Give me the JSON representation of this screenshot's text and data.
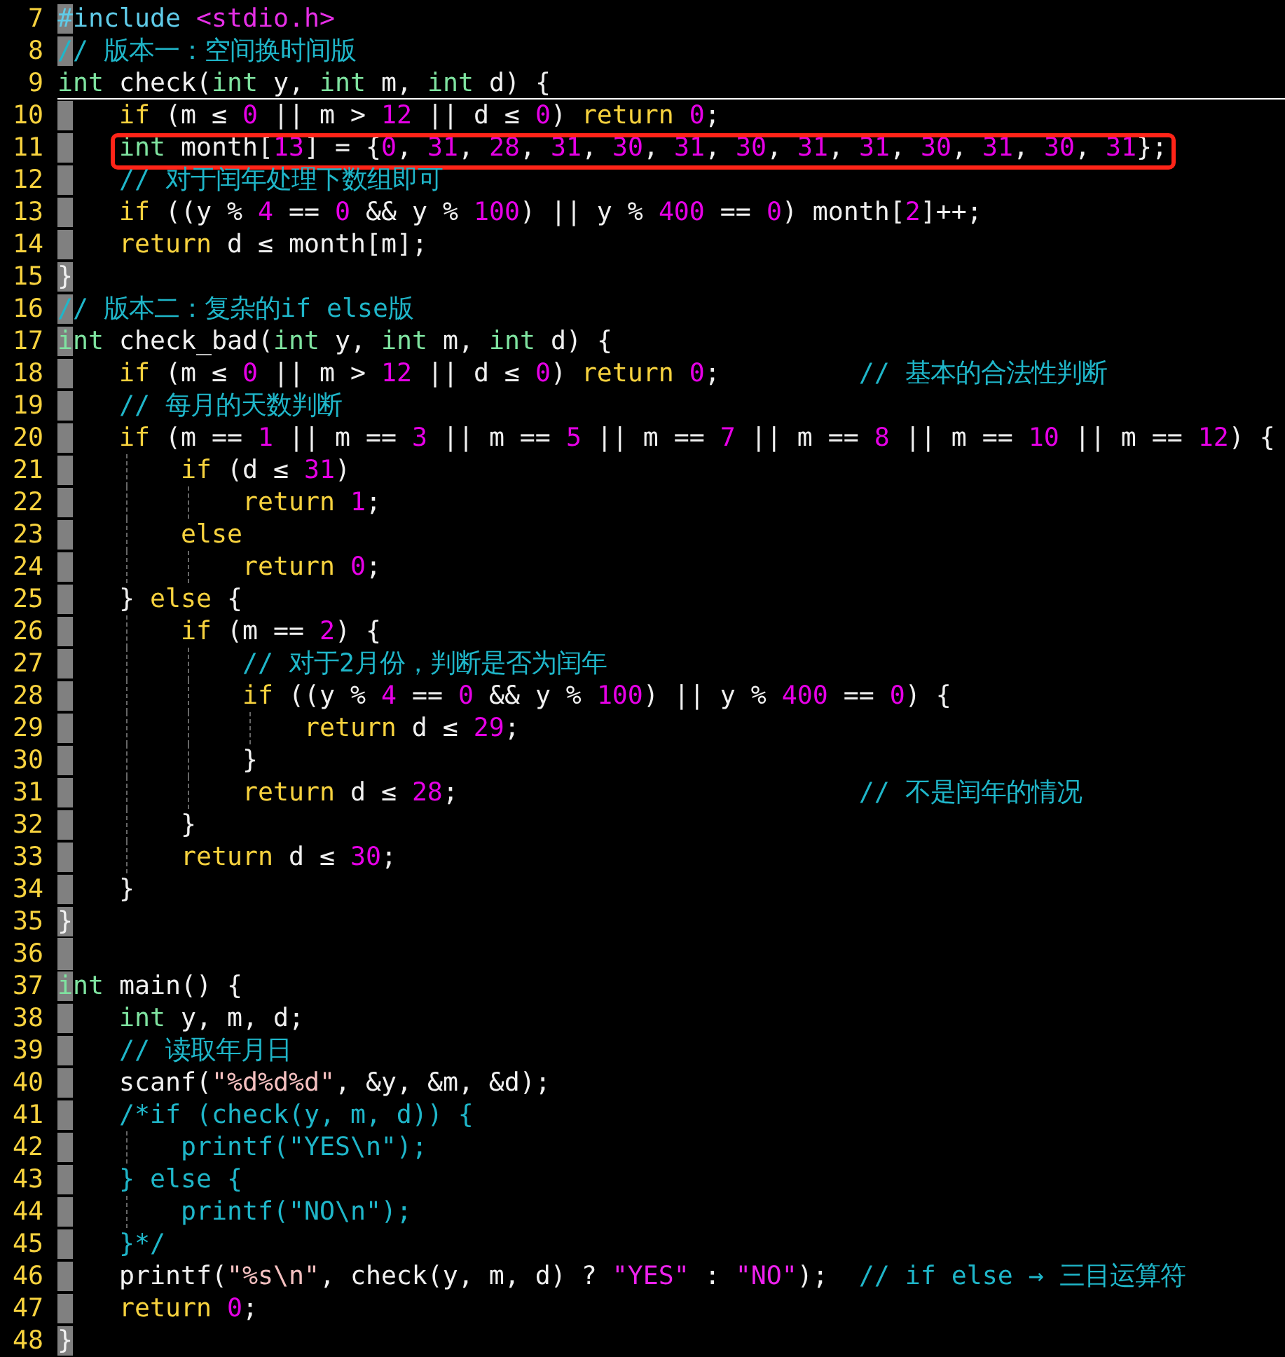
{
  "editor": {
    "lines": [
      {
        "number": "7",
        "current": false,
        "boxed": false,
        "tokens": [
          {
            "text": "#include",
            "kind": "preproc"
          },
          {
            "text": " <stdio.h>",
            "kind": "include"
          }
        ]
      },
      {
        "number": "8",
        "current": false,
        "boxed": false,
        "tokens": [
          {
            "text": "// 版本一：空间换时间版",
            "kind": "comment"
          }
        ]
      },
      {
        "number": "9",
        "current": true,
        "boxed": false,
        "tokens": [
          {
            "text": "int",
            "kind": "type"
          },
          {
            "text": " check(",
            "kind": "plain"
          },
          {
            "text": "int",
            "kind": "type"
          },
          {
            "text": " y, ",
            "kind": "plain"
          },
          {
            "text": "int",
            "kind": "type"
          },
          {
            "text": " m, ",
            "kind": "plain"
          },
          {
            "text": "int",
            "kind": "type"
          },
          {
            "text": " d) {",
            "kind": "plain"
          }
        ]
      },
      {
        "number": "10",
        "current": false,
        "boxed": false,
        "tokens": [
          {
            "text": "    if",
            "kind": "keyword"
          },
          {
            "text": " (m ≤ ",
            "kind": "plain"
          },
          {
            "text": "0",
            "kind": "number"
          },
          {
            "text": " || m > ",
            "kind": "plain"
          },
          {
            "text": "12",
            "kind": "number"
          },
          {
            "text": " || d ≤ ",
            "kind": "plain"
          },
          {
            "text": "0",
            "kind": "number"
          },
          {
            "text": ") ",
            "kind": "plain"
          },
          {
            "text": "return",
            "kind": "keyword"
          },
          {
            "text": " 0",
            "kind": "number"
          },
          {
            "text": ";",
            "kind": "plain"
          }
        ]
      },
      {
        "number": "11",
        "current": false,
        "boxed": true,
        "tokens": [
          {
            "text": "    int",
            "kind": "type"
          },
          {
            "text": " month[",
            "kind": "plain"
          },
          {
            "text": "13",
            "kind": "number"
          },
          {
            "text": "] = {",
            "kind": "plain"
          },
          {
            "text": "0",
            "kind": "number"
          },
          {
            "text": ", ",
            "kind": "plain"
          },
          {
            "text": "31",
            "kind": "number"
          },
          {
            "text": ", ",
            "kind": "plain"
          },
          {
            "text": "28",
            "kind": "number"
          },
          {
            "text": ", ",
            "kind": "plain"
          },
          {
            "text": "31",
            "kind": "number"
          },
          {
            "text": ", ",
            "kind": "plain"
          },
          {
            "text": "30",
            "kind": "number"
          },
          {
            "text": ", ",
            "kind": "plain"
          },
          {
            "text": "31",
            "kind": "number"
          },
          {
            "text": ", ",
            "kind": "plain"
          },
          {
            "text": "30",
            "kind": "number"
          },
          {
            "text": ", ",
            "kind": "plain"
          },
          {
            "text": "31",
            "kind": "number"
          },
          {
            "text": ", ",
            "kind": "plain"
          },
          {
            "text": "31",
            "kind": "number"
          },
          {
            "text": ", ",
            "kind": "plain"
          },
          {
            "text": "30",
            "kind": "number"
          },
          {
            "text": ", ",
            "kind": "plain"
          },
          {
            "text": "31",
            "kind": "number"
          },
          {
            "text": ", ",
            "kind": "plain"
          },
          {
            "text": "30",
            "kind": "number"
          },
          {
            "text": ", ",
            "kind": "plain"
          },
          {
            "text": "31",
            "kind": "number"
          },
          {
            "text": "};",
            "kind": "plain"
          }
        ]
      },
      {
        "number": "12",
        "current": false,
        "boxed": false,
        "tokens": [
          {
            "text": "    // 对于闰年处理下数组即可",
            "kind": "comment"
          }
        ]
      },
      {
        "number": "13",
        "current": false,
        "boxed": false,
        "tokens": [
          {
            "text": "    if",
            "kind": "keyword"
          },
          {
            "text": " ((y % ",
            "kind": "plain"
          },
          {
            "text": "4",
            "kind": "number"
          },
          {
            "text": " == ",
            "kind": "plain"
          },
          {
            "text": "0",
            "kind": "number"
          },
          {
            "text": " && y % ",
            "kind": "plain"
          },
          {
            "text": "100",
            "kind": "number"
          },
          {
            "text": ") || y % ",
            "kind": "plain"
          },
          {
            "text": "400",
            "kind": "number"
          },
          {
            "text": " == ",
            "kind": "plain"
          },
          {
            "text": "0",
            "kind": "number"
          },
          {
            "text": ") month[",
            "kind": "plain"
          },
          {
            "text": "2",
            "kind": "number"
          },
          {
            "text": "]++;",
            "kind": "plain"
          }
        ]
      },
      {
        "number": "14",
        "current": false,
        "boxed": false,
        "tokens": [
          {
            "text": "    return",
            "kind": "keyword"
          },
          {
            "text": " d ≤ month[m];",
            "kind": "plain"
          }
        ]
      },
      {
        "number": "15",
        "current": false,
        "boxed": false,
        "tokens": [
          {
            "text": "}",
            "kind": "plain"
          }
        ]
      },
      {
        "number": "16",
        "current": false,
        "boxed": false,
        "tokens": [
          {
            "text": "// 版本二：复杂的if else版",
            "kind": "comment"
          }
        ]
      },
      {
        "number": "17",
        "current": false,
        "boxed": false,
        "tokens": [
          {
            "text": "int",
            "kind": "type"
          },
          {
            "text": " check_bad(",
            "kind": "plain"
          },
          {
            "text": "int",
            "kind": "type"
          },
          {
            "text": " y, ",
            "kind": "plain"
          },
          {
            "text": "int",
            "kind": "type"
          },
          {
            "text": " m, ",
            "kind": "plain"
          },
          {
            "text": "int",
            "kind": "type"
          },
          {
            "text": " d) {",
            "kind": "plain"
          }
        ]
      },
      {
        "number": "18",
        "current": false,
        "boxed": false,
        "tokens": [
          {
            "text": "    if",
            "kind": "keyword"
          },
          {
            "text": " (m ≤ ",
            "kind": "plain"
          },
          {
            "text": "0",
            "kind": "number"
          },
          {
            "text": " || m > ",
            "kind": "plain"
          },
          {
            "text": "12",
            "kind": "number"
          },
          {
            "text": " || d ≤ ",
            "kind": "plain"
          },
          {
            "text": "0",
            "kind": "number"
          },
          {
            "text": ") ",
            "kind": "plain"
          },
          {
            "text": "return",
            "kind": "keyword"
          },
          {
            "text": " 0",
            "kind": "number"
          },
          {
            "text": ";",
            "kind": "plain"
          },
          {
            "text": "         // 基本的合法性判断",
            "kind": "comment"
          }
        ]
      },
      {
        "number": "19",
        "current": false,
        "boxed": false,
        "tokens": [
          {
            "text": "    // 每月的天数判断",
            "kind": "comment"
          }
        ]
      },
      {
        "number": "20",
        "current": false,
        "boxed": false,
        "tokens": [
          {
            "text": "    if",
            "kind": "keyword"
          },
          {
            "text": " (m == ",
            "kind": "plain"
          },
          {
            "text": "1",
            "kind": "number"
          },
          {
            "text": " || m == ",
            "kind": "plain"
          },
          {
            "text": "3",
            "kind": "number"
          },
          {
            "text": " || m == ",
            "kind": "plain"
          },
          {
            "text": "5",
            "kind": "number"
          },
          {
            "text": " || m == ",
            "kind": "plain"
          },
          {
            "text": "7",
            "kind": "number"
          },
          {
            "text": " || m == ",
            "kind": "plain"
          },
          {
            "text": "8",
            "kind": "number"
          },
          {
            "text": " || m == ",
            "kind": "plain"
          },
          {
            "text": "10",
            "kind": "number"
          },
          {
            "text": " || m == ",
            "kind": "plain"
          },
          {
            "text": "12",
            "kind": "number"
          },
          {
            "text": ") {",
            "kind": "plain"
          }
        ]
      },
      {
        "number": "21",
        "current": false,
        "boxed": false,
        "tokens": [
          {
            "text": "        if",
            "kind": "keyword"
          },
          {
            "text": " (d ≤ ",
            "kind": "plain"
          },
          {
            "text": "31",
            "kind": "number"
          },
          {
            "text": ")",
            "kind": "plain"
          }
        ]
      },
      {
        "number": "22",
        "current": false,
        "boxed": false,
        "tokens": [
          {
            "text": "            return",
            "kind": "keyword"
          },
          {
            "text": " 1",
            "kind": "number"
          },
          {
            "text": ";",
            "kind": "plain"
          }
        ]
      },
      {
        "number": "23",
        "current": false,
        "boxed": false,
        "tokens": [
          {
            "text": "        else",
            "kind": "keyword"
          }
        ]
      },
      {
        "number": "24",
        "current": false,
        "boxed": false,
        "tokens": [
          {
            "text": "            return",
            "kind": "keyword"
          },
          {
            "text": " 0",
            "kind": "number"
          },
          {
            "text": ";",
            "kind": "plain"
          }
        ]
      },
      {
        "number": "25",
        "current": false,
        "boxed": false,
        "tokens": [
          {
            "text": "    }",
            "kind": "plain"
          },
          {
            "text": " else",
            "kind": "keyword"
          },
          {
            "text": " {",
            "kind": "plain"
          }
        ]
      },
      {
        "number": "26",
        "current": false,
        "boxed": false,
        "tokens": [
          {
            "text": "        if",
            "kind": "keyword"
          },
          {
            "text": " (m == ",
            "kind": "plain"
          },
          {
            "text": "2",
            "kind": "number"
          },
          {
            "text": ") {",
            "kind": "plain"
          }
        ]
      },
      {
        "number": "27",
        "current": false,
        "boxed": false,
        "tokens": [
          {
            "text": "            // 对于2月份，判断是否为闰年",
            "kind": "comment"
          }
        ]
      },
      {
        "number": "28",
        "current": false,
        "boxed": false,
        "tokens": [
          {
            "text": "            if",
            "kind": "keyword"
          },
          {
            "text": " ((y % ",
            "kind": "plain"
          },
          {
            "text": "4",
            "kind": "number"
          },
          {
            "text": " == ",
            "kind": "plain"
          },
          {
            "text": "0",
            "kind": "number"
          },
          {
            "text": " && y % ",
            "kind": "plain"
          },
          {
            "text": "100",
            "kind": "number"
          },
          {
            "text": ") || y % ",
            "kind": "plain"
          },
          {
            "text": "400",
            "kind": "number"
          },
          {
            "text": " == ",
            "kind": "plain"
          },
          {
            "text": "0",
            "kind": "number"
          },
          {
            "text": ") {",
            "kind": "plain"
          }
        ]
      },
      {
        "number": "29",
        "current": false,
        "boxed": false,
        "tokens": [
          {
            "text": "                return",
            "kind": "keyword"
          },
          {
            "text": " d ≤ ",
            "kind": "plain"
          },
          {
            "text": "29",
            "kind": "number"
          },
          {
            "text": ";",
            "kind": "plain"
          }
        ]
      },
      {
        "number": "30",
        "current": false,
        "boxed": false,
        "tokens": [
          {
            "text": "            }",
            "kind": "plain"
          }
        ]
      },
      {
        "number": "31",
        "current": false,
        "boxed": false,
        "tokens": [
          {
            "text": "            return",
            "kind": "keyword"
          },
          {
            "text": " d ≤ ",
            "kind": "plain"
          },
          {
            "text": "28",
            "kind": "number"
          },
          {
            "text": ";",
            "kind": "plain"
          },
          {
            "text": "                          // 不是闰年的情况",
            "kind": "comment"
          }
        ]
      },
      {
        "number": "32",
        "current": false,
        "boxed": false,
        "tokens": [
          {
            "text": "        }",
            "kind": "plain"
          }
        ]
      },
      {
        "number": "33",
        "current": false,
        "boxed": false,
        "tokens": [
          {
            "text": "        return",
            "kind": "keyword"
          },
          {
            "text": " d ≤ ",
            "kind": "plain"
          },
          {
            "text": "30",
            "kind": "number"
          },
          {
            "text": ";",
            "kind": "plain"
          }
        ]
      },
      {
        "number": "34",
        "current": false,
        "boxed": false,
        "tokens": [
          {
            "text": "    }",
            "kind": "plain"
          }
        ]
      },
      {
        "number": "35",
        "current": false,
        "boxed": false,
        "tokens": [
          {
            "text": "}",
            "kind": "plain"
          }
        ]
      },
      {
        "number": "36",
        "current": false,
        "boxed": false
      },
      {
        "number": "37",
        "current": false,
        "boxed": false,
        "tokens": [
          {
            "text": "int",
            "kind": "type"
          },
          {
            "text": " main() {",
            "kind": "plain"
          }
        ]
      },
      {
        "number": "38",
        "current": false,
        "boxed": false,
        "tokens": [
          {
            "text": "    int",
            "kind": "type"
          },
          {
            "text": " y, m, d;",
            "kind": "plain"
          }
        ]
      },
      {
        "number": "39",
        "current": false,
        "boxed": false,
        "tokens": [
          {
            "text": "    // 读取年月日",
            "kind": "comment"
          }
        ]
      },
      {
        "number": "40",
        "current": false,
        "boxed": false,
        "tokens": [
          {
            "text": "    scanf(",
            "kind": "plain"
          },
          {
            "text": "\"%d%d%d\"",
            "kind": "format"
          },
          {
            "text": ", &y, &m, &d);",
            "kind": "plain"
          }
        ]
      },
      {
        "number": "41",
        "current": false,
        "boxed": false,
        "tokens": [
          {
            "text": "    /*if (check(y, m, d)) {",
            "kind": "comment"
          }
        ]
      },
      {
        "number": "42",
        "current": false,
        "boxed": false,
        "tokens": [
          {
            "text": "        printf(\"YES\\n\");",
            "kind": "comment"
          }
        ]
      },
      {
        "number": "43",
        "current": false,
        "boxed": false,
        "tokens": [
          {
            "text": "    } else {",
            "kind": "comment"
          }
        ]
      },
      {
        "number": "44",
        "current": false,
        "boxed": false,
        "tokens": [
          {
            "text": "        printf(\"NO\\n\");",
            "kind": "comment"
          }
        ]
      },
      {
        "number": "45",
        "current": false,
        "boxed": false,
        "tokens": [
          {
            "text": "    }*/",
            "kind": "comment"
          }
        ]
      },
      {
        "number": "46",
        "current": false,
        "boxed": false,
        "tokens": [
          {
            "text": "    printf(",
            "kind": "plain"
          },
          {
            "text": "\"%s\\n\"",
            "kind": "format"
          },
          {
            "text": ", check(y, m, d) ? ",
            "kind": "plain"
          },
          {
            "text": "\"YES\"",
            "kind": "string"
          },
          {
            "text": " : ",
            "kind": "plain"
          },
          {
            "text": "\"NO\"",
            "kind": "string"
          },
          {
            "text": ");",
            "kind": "plain"
          },
          {
            "text": "  // if else → 三目运算符",
            "kind": "comment"
          }
        ]
      },
      {
        "number": "47",
        "current": false,
        "boxed": false,
        "tokens": [
          {
            "text": "    return",
            "kind": "keyword"
          },
          {
            "text": " 0",
            "kind": "number"
          },
          {
            "text": ";",
            "kind": "plain"
          }
        ]
      },
      {
        "number": "48",
        "current": false,
        "boxed": false,
        "tokens": [
          {
            "text": "}",
            "kind": "plain"
          }
        ]
      }
    ]
  }
}
